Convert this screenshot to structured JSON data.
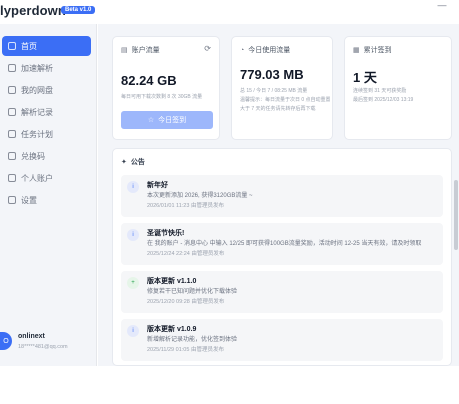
{
  "app": {
    "brand": "lyperdown",
    "version_badge": "Beta v1.0",
    "close_glyph": "—"
  },
  "sidebar": {
    "items": [
      {
        "label": "首页",
        "active": true
      },
      {
        "label": "加速解析",
        "active": false
      },
      {
        "label": "我的网盘",
        "active": false
      },
      {
        "label": "解析记录",
        "active": false
      },
      {
        "label": "任务计划",
        "active": false
      },
      {
        "label": "兑换码",
        "active": false
      },
      {
        "label": "个人账户",
        "active": false
      },
      {
        "label": "设置",
        "active": false
      }
    ],
    "user": {
      "avatar_letter": "O",
      "name": "onlinext",
      "email": "18*****481@qq.com"
    }
  },
  "cards": {
    "account": {
      "title": "账户流量",
      "value": "82.24 GB",
      "sub": "每日可用下载次数剩 8 次 30GB 流量",
      "button": "今日签到"
    },
    "today": {
      "title": "今日使用流量",
      "value": "779.03 MB",
      "sub1": "总 15 / 今日 7 / 08:25 MB 流量",
      "sub2": "温馨提示：每日流量于次日 0 点自动重置",
      "sub3": "大于 7 天的任务请先转存后再下载"
    },
    "checkin": {
      "title": "累计签到",
      "value": "1 天",
      "sub1": "连续签到 31 天可获奖励",
      "sub2": "最后签到 2025/12/03 13:19"
    }
  },
  "notices": {
    "title": "公告",
    "items": [
      {
        "icon": "i",
        "title": "新年好",
        "body": "本次更新添加 2026, 获得3120GB流量 ~",
        "meta": "2026/01/01 11:23  由管理员发布"
      },
      {
        "icon": "i",
        "title": "圣诞节快乐!",
        "body": "在 我的账户 - 消息中心 中输入 12/25 即可获得100GB流量奖励，活动时间 12-25 当天有效，请及时领取",
        "meta": "2025/12/24 22:24  由管理员发布"
      },
      {
        "icon": "+",
        "title": "版本更新 v1.1.0",
        "body": "修复若干已知问题并优化下载体验",
        "meta": "2025/12/20 09:28  由管理员发布"
      },
      {
        "icon": "i",
        "title": "版本更新 v1.0.9",
        "body": "新增解析记录功能，优化签到体验",
        "meta": "2025/11/29 01:05  由管理员发布"
      }
    ]
  }
}
